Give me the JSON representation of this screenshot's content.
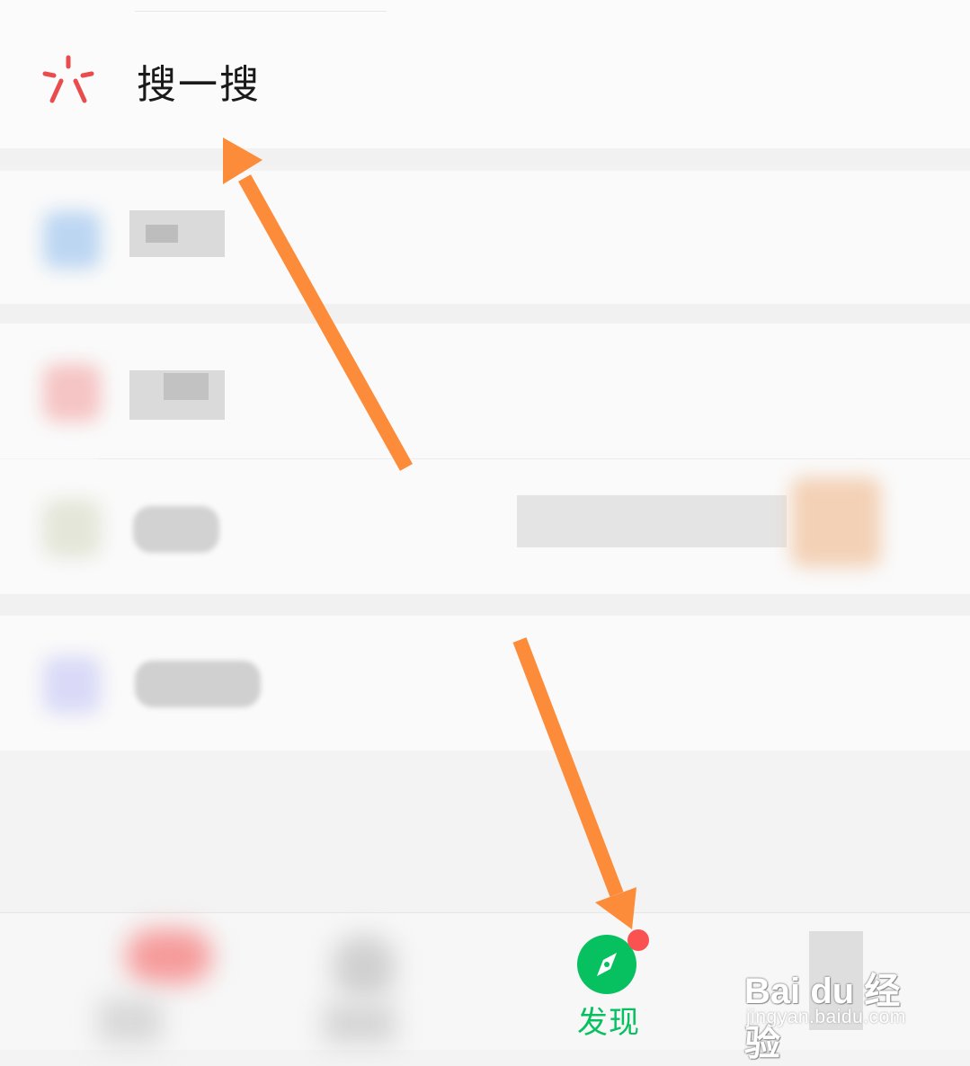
{
  "search": {
    "label": "搜一搜",
    "icon": "search-spark-icon",
    "accent": "#e94c4c"
  },
  "tabbar": {
    "discover_label": "发现",
    "discover_icon": "compass-icon",
    "active_color": "#07c160",
    "badge_color": "#fa5151"
  },
  "watermark": {
    "logo": "Bai du 经验",
    "url": "jingyan.baidu.com"
  },
  "annotation_color": "#fd8c3a"
}
